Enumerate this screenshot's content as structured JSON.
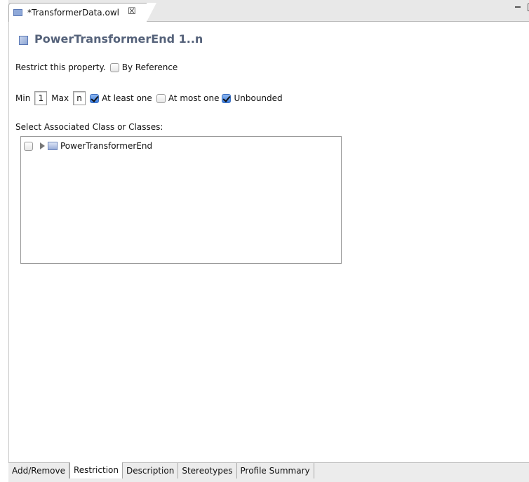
{
  "editor_tab": {
    "title": "*TransformerData.owl",
    "close_glyph": "☒"
  },
  "header": {
    "title": "PowerTransformerEnd 1..n"
  },
  "restrict": {
    "label": "Restrict this property.",
    "by_reference_label": "By Reference",
    "by_reference_checked": false
  },
  "cardinality": {
    "min_label": "Min",
    "min_value": "1",
    "max_label": "Max",
    "max_value": "n",
    "at_least_one_label": "At least one",
    "at_least_one_checked": true,
    "at_most_one_label": "At most one",
    "at_most_one_checked": false,
    "unbounded_label": "Unbounded",
    "unbounded_checked": true
  },
  "associated": {
    "label": "Select Associated Class or Classes:",
    "items": [
      {
        "label": "PowerTransformerEnd",
        "checked": false,
        "expandable": true
      }
    ]
  },
  "bottom_tabs": [
    {
      "label": "Add/Remove",
      "active": false
    },
    {
      "label": "Restriction",
      "active": true
    },
    {
      "label": "Description",
      "active": false
    },
    {
      "label": "Stereotypes",
      "active": false
    },
    {
      "label": "Profile Summary",
      "active": false
    }
  ]
}
